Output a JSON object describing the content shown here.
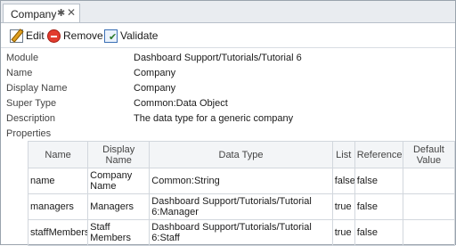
{
  "tab": {
    "title": "Company",
    "pin_glyph": "✱",
    "close_glyph": "✕"
  },
  "toolbar": {
    "edit_label": "Edit",
    "remove_label": "Remove",
    "validate_label": "Validate"
  },
  "properties": [
    {
      "key": "Module",
      "value": "Dashboard Support/Tutorials/Tutorial 6"
    },
    {
      "key": "Name",
      "value": "Company"
    },
    {
      "key": "Display Name",
      "value": "Company"
    },
    {
      "key": "Super Type",
      "value": "Common:Data Object"
    },
    {
      "key": "Description",
      "value": "The data type for a generic company"
    },
    {
      "key": "Properties",
      "value": ""
    }
  ],
  "grid": {
    "headers": [
      "Name",
      "Display Name",
      "Data Type",
      "List",
      "Reference",
      "Default Value"
    ],
    "rows": [
      [
        "name",
        "Company Name",
        "Common:String",
        "false",
        "false",
        ""
      ],
      [
        "managers",
        "Managers",
        "Dashboard Support/Tutorials/Tutorial 6:Manager",
        "true",
        "false",
        ""
      ],
      [
        "staffMembers",
        "Staff Members",
        "Dashboard Support/Tutorials/Tutorial 6:Staff",
        "true",
        "false",
        ""
      ]
    ]
  }
}
